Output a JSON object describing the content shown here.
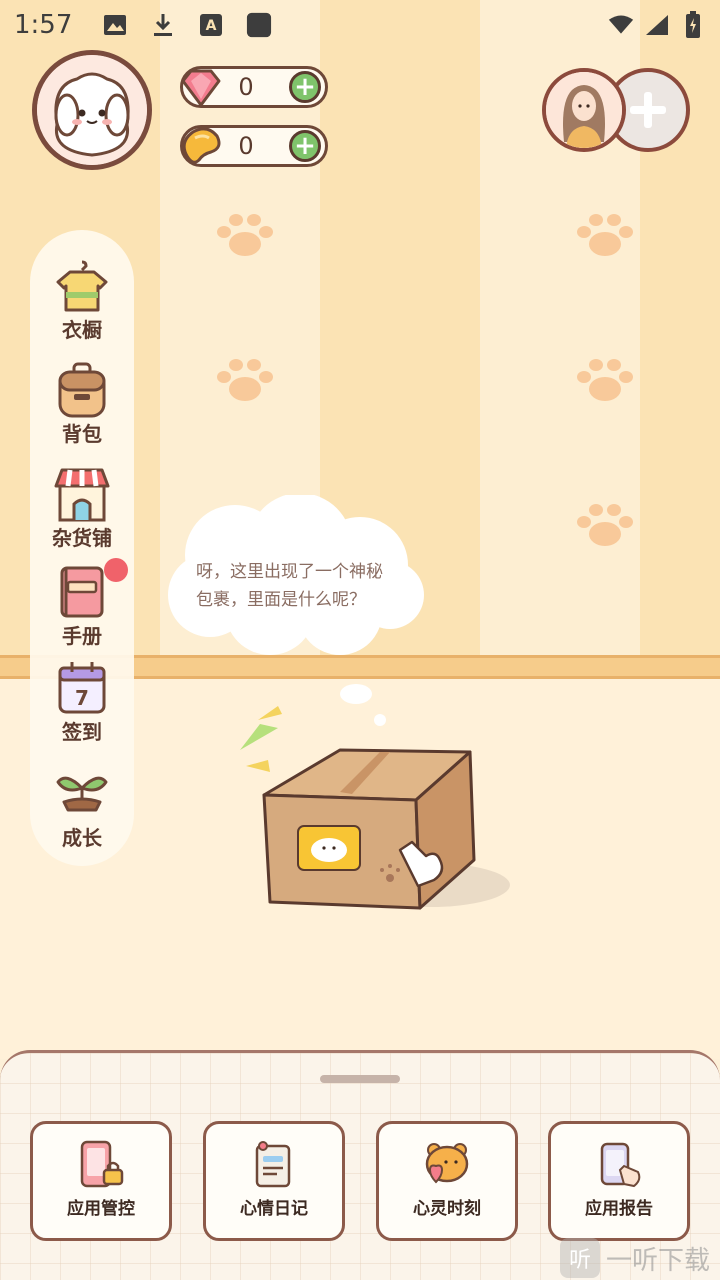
{
  "status_bar": {
    "time": "1:57",
    "left_icons": [
      "image-icon",
      "download-icon",
      "text-icon",
      "square-icon"
    ],
    "right_icons": [
      "wifi-icon",
      "signal-icon",
      "battery-icon"
    ]
  },
  "currencies": {
    "gems": {
      "value": "0",
      "icon": "gem-icon"
    },
    "beans": {
      "value": "0",
      "icon": "bean-icon"
    }
  },
  "sidebar": {
    "items": [
      {
        "label": "衣橱",
        "icon": "wardrobe-icon"
      },
      {
        "label": "背包",
        "icon": "backpack-icon"
      },
      {
        "label": "杂货铺",
        "icon": "shop-icon"
      },
      {
        "label": "手册",
        "icon": "handbook-icon",
        "badge": true
      },
      {
        "label": "签到",
        "icon": "calendar-icon",
        "calendar_day": "7"
      },
      {
        "label": "成长",
        "icon": "sprout-icon"
      }
    ]
  },
  "speech": {
    "text_line1": "呀，这里出现了一个神秘",
    "text_line2": "包裹，里面是什么呢？"
  },
  "bottom_panel": {
    "cards": [
      {
        "label": "应用管控",
        "icon": "phone-lock-icon"
      },
      {
        "label": "心情日记",
        "icon": "diary-icon"
      },
      {
        "label": "心灵时刻",
        "icon": "bear-heart-icon"
      },
      {
        "label": "应用报告",
        "icon": "report-icon"
      }
    ]
  },
  "watermark": {
    "text": "一听下载",
    "mark": "听"
  },
  "colors": {
    "wall": "#fbe3b4",
    "floor": "#fff1d9",
    "outline": "#6e4838",
    "accent_green": "#7fc46b",
    "badge_red": "#f0626a"
  }
}
